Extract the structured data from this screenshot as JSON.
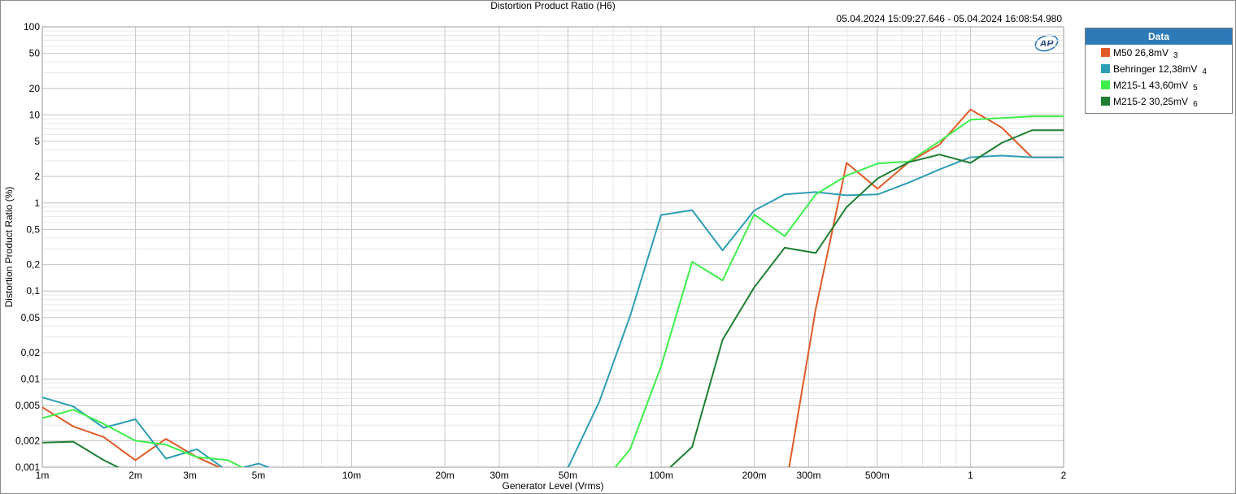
{
  "window": {
    "title": "Distortion Product Ratio (H6)",
    "timestamp": "05.04.2024 15:09:27.646 - 05.04.2024 16:08:54.980",
    "logo_text": "AP"
  },
  "legend": {
    "header": "Data",
    "items": [
      {
        "name": "M50  26,8mV",
        "index": "3",
        "color": "#e05a28"
      },
      {
        "name": "Behringer  12,38mV",
        "index": "4",
        "color": "#2e9eb4"
      },
      {
        "name": "M215-1  43,60mV",
        "index": "5",
        "color": "#3cf04a"
      },
      {
        "name": "M215-2  30,25mV",
        "index": "6",
        "color": "#1e7e32"
      }
    ]
  },
  "chart_data": {
    "type": "line",
    "title": "Distortion Product Ratio (H6)",
    "xlabel": "Generator Level (Vrms)",
    "ylabel": "Distortion Product Ratio (%)",
    "x_scale": "log",
    "y_scale": "log",
    "xlim": [
      0.001,
      2
    ],
    "ylim": [
      0.001,
      100
    ],
    "grid": true,
    "legend_position": "right",
    "x_ticks": [
      {
        "value": 0.001,
        "label": "1m"
      },
      {
        "value": 0.002,
        "label": "2m"
      },
      {
        "value": 0.003,
        "label": "3m"
      },
      {
        "value": 0.005,
        "label": "5m"
      },
      {
        "value": 0.01,
        "label": "10m"
      },
      {
        "value": 0.02,
        "label": "20m"
      },
      {
        "value": 0.03,
        "label": "30m"
      },
      {
        "value": 0.05,
        "label": "50m"
      },
      {
        "value": 0.1,
        "label": "100m"
      },
      {
        "value": 0.2,
        "label": "200m"
      },
      {
        "value": 0.3,
        "label": "300m"
      },
      {
        "value": 0.5,
        "label": "500m"
      },
      {
        "value": 1,
        "label": "1"
      },
      {
        "value": 2,
        "label": "2"
      }
    ],
    "y_ticks": [
      {
        "value": 100,
        "label": "100"
      },
      {
        "value": 50,
        "label": "50"
      },
      {
        "value": 20,
        "label": "20"
      },
      {
        "value": 10,
        "label": "10"
      },
      {
        "value": 5,
        "label": "5"
      },
      {
        "value": 2,
        "label": "2"
      },
      {
        "value": 1,
        "label": "1"
      },
      {
        "value": 0.5,
        "label": "0,5"
      },
      {
        "value": 0.2,
        "label": "0,2"
      },
      {
        "value": 0.1,
        "label": "0,1"
      },
      {
        "value": 0.05,
        "label": "0,05"
      },
      {
        "value": 0.02,
        "label": "0,02"
      },
      {
        "value": 0.01,
        "label": "0,01"
      },
      {
        "value": 0.005,
        "label": "0,005"
      },
      {
        "value": 0.002,
        "label": "0,002"
      },
      {
        "value": 0.001,
        "label": "0,001"
      }
    ],
    "series": [
      {
        "name": "M50  26,8mV 3",
        "color": "#e05a28",
        "x": [
          0.001,
          0.00126,
          0.00158,
          0.002,
          0.00251,
          0.00316,
          0.00398,
          0.00501,
          0.00631,
          0.00794,
          0.01,
          0.0126,
          0.0158,
          0.02,
          0.0251,
          0.0316,
          0.0398,
          0.0501,
          0.0631,
          0.0794,
          0.1,
          0.126,
          0.158,
          0.2,
          0.251,
          0.316,
          0.398,
          0.501,
          0.631,
          0.794,
          1,
          1.26,
          1.58,
          2
        ],
        "y": [
          0.0048,
          0.0029,
          0.0022,
          0.0012,
          0.0021,
          0.0013,
          0.0009,
          0.0005,
          0.0005,
          0.0005,
          0.0005,
          0.0005,
          0.0005,
          0.0005,
          0.0005,
          0.0005,
          0.0005,
          0.0005,
          0.0005,
          0.0005,
          0.0005,
          0.0005,
          0.0005,
          0.0005,
          0.0005,
          0.062,
          2.85,
          1.45,
          2.9,
          4.6,
          11.5,
          7.2,
          3.3,
          3.3
        ]
      },
      {
        "name": "Behringer  12,38mV 4",
        "color": "#2e9eb4",
        "x": [
          0.001,
          0.00126,
          0.00158,
          0.002,
          0.00251,
          0.00316,
          0.00398,
          0.00501,
          0.00631,
          0.00794,
          0.01,
          0.0126,
          0.0158,
          0.02,
          0.0251,
          0.0316,
          0.0398,
          0.0501,
          0.0631,
          0.0794,
          0.1,
          0.126,
          0.158,
          0.2,
          0.251,
          0.316,
          0.398,
          0.501,
          0.631,
          0.794,
          1,
          1.26,
          1.58,
          2
        ],
        "y": [
          0.0062,
          0.0049,
          0.0028,
          0.0035,
          0.00125,
          0.0016,
          0.0009,
          0.0011,
          0.0008,
          0.0008,
          0.0008,
          0.0008,
          0.0008,
          0.0008,
          0.0008,
          0.0008,
          0.0008,
          0.001,
          0.0055,
          0.052,
          0.73,
          0.83,
          0.29,
          0.82,
          1.25,
          1.33,
          1.22,
          1.25,
          1.7,
          2.4,
          3.3,
          3.45,
          3.3,
          3.3
        ]
      },
      {
        "name": "M215-1  43,60mV 5",
        "color": "#3cf04a",
        "x": [
          0.001,
          0.00126,
          0.00158,
          0.002,
          0.00251,
          0.00316,
          0.00398,
          0.00501,
          0.00631,
          0.00794,
          0.01,
          0.0126,
          0.0158,
          0.02,
          0.0251,
          0.0316,
          0.0398,
          0.0501,
          0.0631,
          0.0794,
          0.1,
          0.126,
          0.158,
          0.2,
          0.251,
          0.316,
          0.398,
          0.501,
          0.631,
          0.794,
          1,
          1.26,
          1.58,
          2
        ],
        "y": [
          0.0036,
          0.0045,
          0.0031,
          0.002,
          0.0018,
          0.0013,
          0.0012,
          0.0008,
          0.0008,
          0.0008,
          0.0008,
          0.0008,
          0.0008,
          0.0008,
          0.0008,
          0.0008,
          0.0008,
          0.0008,
          0.0006,
          0.0016,
          0.014,
          0.215,
          0.132,
          0.74,
          0.42,
          1.25,
          2.05,
          2.8,
          2.95,
          5.0,
          8.8,
          9.2,
          9.6,
          9.6
        ]
      },
      {
        "name": "M215-2  30,25mV 6",
        "color": "#1e7e32",
        "x": [
          0.001,
          0.00126,
          0.00158,
          0.002,
          0.00251,
          0.00316,
          0.00398,
          0.00501,
          0.00631,
          0.00794,
          0.01,
          0.0126,
          0.0158,
          0.02,
          0.0251,
          0.0316,
          0.0398,
          0.0501,
          0.0631,
          0.0794,
          0.1,
          0.126,
          0.158,
          0.2,
          0.251,
          0.316,
          0.398,
          0.501,
          0.631,
          0.794,
          1,
          1.26,
          1.58,
          2
        ],
        "y": [
          0.0019,
          0.00195,
          0.0012,
          0.0008,
          0.0008,
          0.0008,
          0.0008,
          0.0008,
          0.0008,
          0.0008,
          0.0008,
          0.0008,
          0.0008,
          0.0008,
          0.0008,
          0.0008,
          0.0008,
          0.0008,
          0.0008,
          0.0008,
          0.0008,
          0.0017,
          0.028,
          0.11,
          0.31,
          0.27,
          0.9,
          1.9,
          2.9,
          3.55,
          2.85,
          4.8,
          6.7,
          6.7
        ]
      }
    ]
  }
}
